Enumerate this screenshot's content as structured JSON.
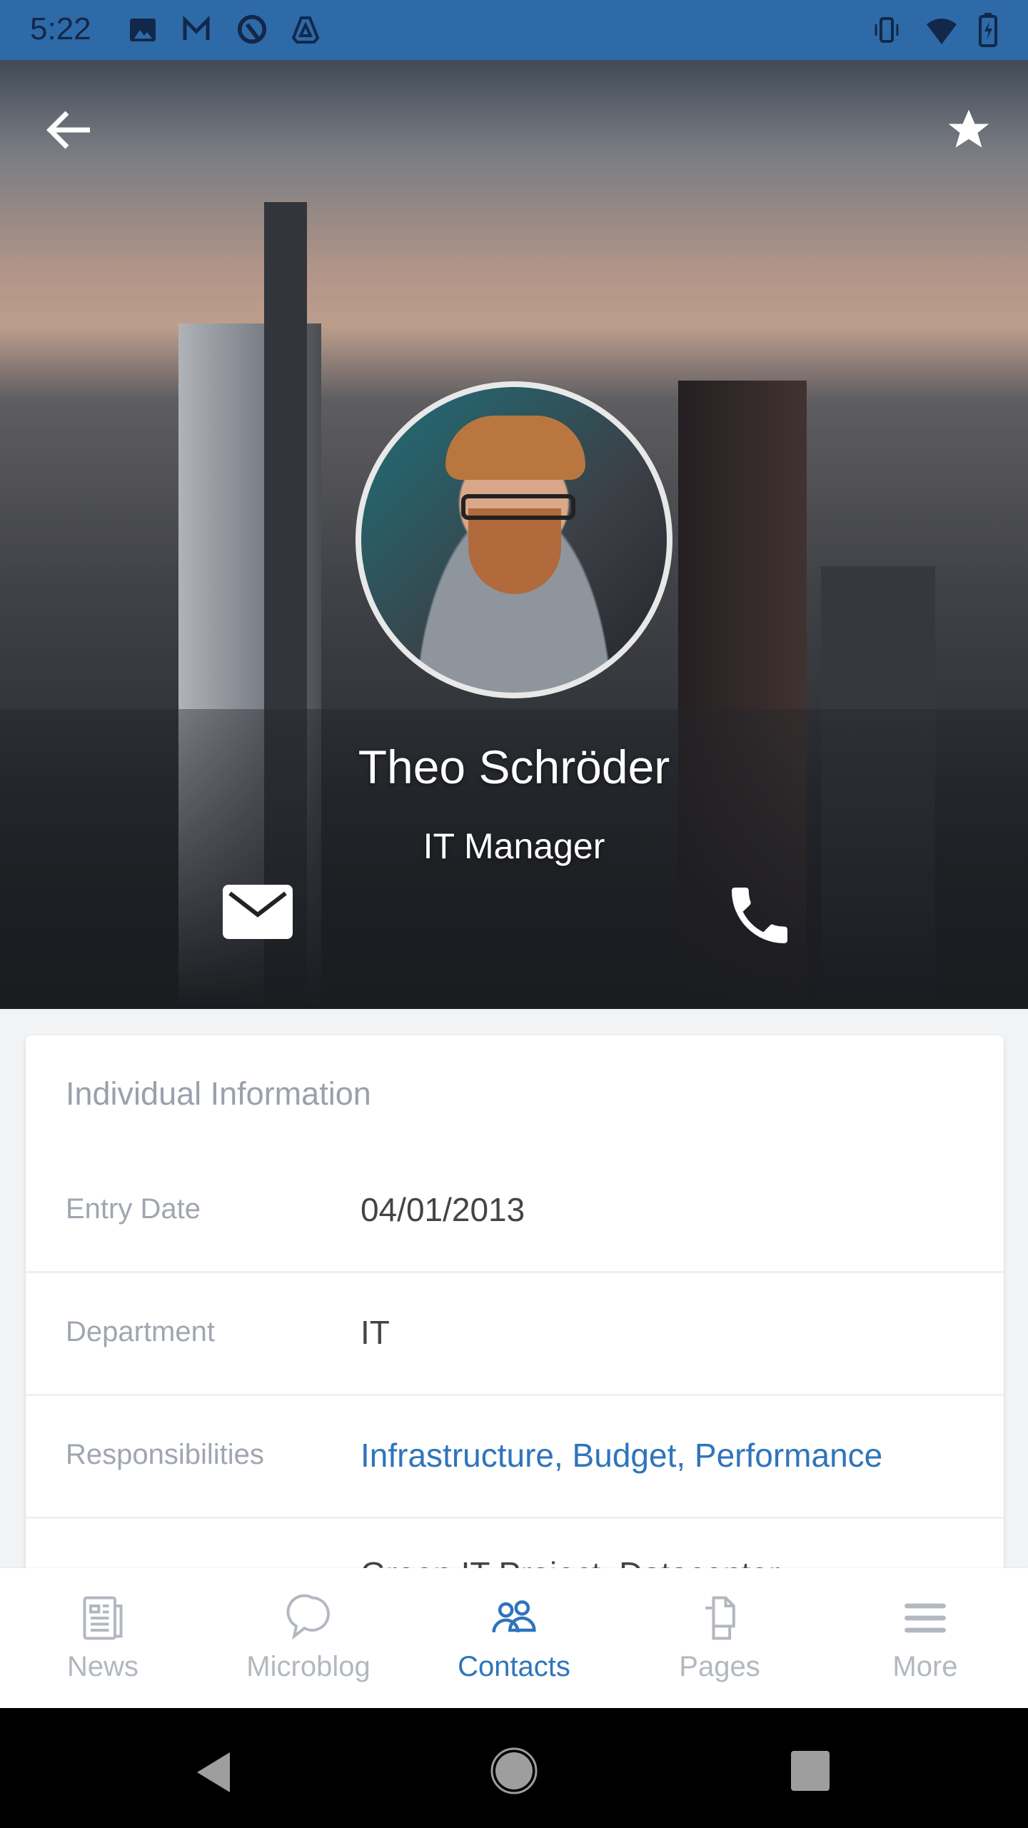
{
  "status_bar": {
    "time": "5:22",
    "icons": [
      "image-icon",
      "gmail-icon",
      "sync-icon",
      "drive-icon",
      "vibrate-icon",
      "wifi-icon",
      "battery-charging-icon"
    ],
    "color": "#2e6aa8"
  },
  "header": {
    "back_icon": "arrow-left-icon",
    "favorite_icon": "star-icon"
  },
  "profile": {
    "name": "Theo Schröder",
    "title": "IT Manager",
    "actions": [
      "mail-icon",
      "phone-icon"
    ]
  },
  "card": {
    "title": "Individual Information",
    "rows": [
      {
        "label": "Entry Date",
        "value": "04/01/2013"
      },
      {
        "label": "Department",
        "value": "IT"
      },
      {
        "label": "Responsibilities",
        "value": "Infrastructure, Budget, Performance",
        "link": true
      },
      {
        "label": "",
        "value": "Green IT Project, Datacenter"
      }
    ]
  },
  "bottom_nav": {
    "active": "Contacts",
    "accent": "#2f74bb",
    "items": [
      {
        "label": "News",
        "icon": "newspaper-icon"
      },
      {
        "label": "Microblog",
        "icon": "chat-bubbles-icon"
      },
      {
        "label": "Contacts",
        "icon": "people-icon"
      },
      {
        "label": "Pages",
        "icon": "pages-icon"
      },
      {
        "label": "More",
        "icon": "menu-icon"
      }
    ]
  },
  "system_nav": [
    "back-icon",
    "home-icon",
    "recents-icon"
  ]
}
